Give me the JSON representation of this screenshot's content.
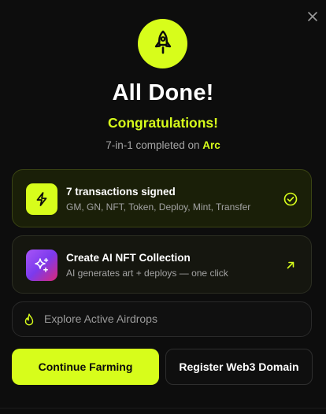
{
  "modal": {
    "title": "All Done!",
    "subtitle": "Congratulations!",
    "status_prefix": "7-in-1 completed on ",
    "status_network": "Arc"
  },
  "cards": {
    "transactions": {
      "title": "7 transactions signed",
      "subtitle": "GM, GN, NFT, Token, Deploy, Mint, Transfer",
      "icon": "lightning-icon",
      "status_icon": "check-circle-icon"
    },
    "nft": {
      "title": "Create AI NFT Collection",
      "subtitle": "AI generates art + deploys — one click",
      "icon": "sparkles-icon",
      "action_icon": "arrow-up-right-icon"
    },
    "airdrops": {
      "label": "Explore Active Airdrops",
      "icon": "flame-icon"
    }
  },
  "buttons": {
    "primary": "Continue Farming",
    "secondary": "Register Web3 Domain"
  },
  "colors": {
    "accent": "#d7fd1b",
    "background": "#0d0d0d",
    "muted_text": "#a6a6a6",
    "nft_gradient": [
      "#a855f7",
      "#7c3aed",
      "#db2777"
    ]
  }
}
